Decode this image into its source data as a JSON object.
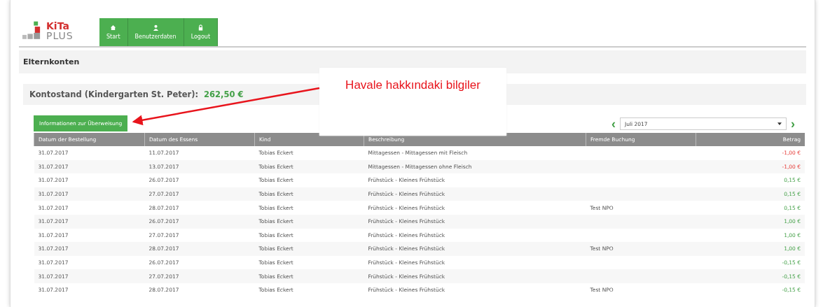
{
  "logo": {
    "top": "KiTa",
    "bottom": "PLUS"
  },
  "nav": [
    {
      "label": "Start",
      "kind": "home"
    },
    {
      "label": "Benutzerdaten",
      "kind": "user"
    },
    {
      "label": "Logout",
      "kind": "lock"
    }
  ],
  "page_title": "Elternkonten",
  "balance": {
    "label": "Kontostand (Kindergarten St. Peter):",
    "amount": "262,50 €"
  },
  "transfer_button": "Informationen zur Überweisung",
  "month_select": {
    "value": "Juli 2017",
    "prev": "‹",
    "next": "›"
  },
  "table": {
    "columns": [
      "Datum der Bestellung",
      "Datum des Essens",
      "Kind",
      "Beschreibung",
      "Fremde Buchung",
      "Betrag"
    ],
    "rows": [
      {
        "cells": [
          "31.07.2017",
          "11.07.2017",
          "Tobias Eckert",
          "Mittagessen - Mittagessen mit Fleisch",
          "",
          "-1,00 €"
        ],
        "negative": true
      },
      {
        "cells": [
          "31.07.2017",
          "13.07.2017",
          "Tobias Eckert",
          "Mittagessen - Mittagessen ohne Fleisch",
          "",
          "-1,00 €"
        ],
        "negative": true
      },
      {
        "cells": [
          "31.07.2017",
          "26.07.2017",
          "Tobias Eckert",
          "Frühstück - Kleines Frühstück",
          "",
          "0,15 €"
        ],
        "negative": false
      },
      {
        "cells": [
          "31.07.2017",
          "27.07.2017",
          "Tobias Eckert",
          "Frühstück - Kleines Frühstück",
          "",
          "0,15 €"
        ],
        "negative": false
      },
      {
        "cells": [
          "31.07.2017",
          "28.07.2017",
          "Tobias Eckert",
          "Frühstück - Kleines Frühstück",
          "Test NPO",
          "0,15 €"
        ],
        "negative": false
      },
      {
        "cells": [
          "31.07.2017",
          "26.07.2017",
          "Tobias Eckert",
          "Frühstück - Kleines Frühstück",
          "",
          "1,00 €"
        ],
        "negative": false
      },
      {
        "cells": [
          "31.07.2017",
          "27.07.2017",
          "Tobias Eckert",
          "Frühstück - Kleines Frühstück",
          "",
          "1,00 €"
        ],
        "negative": false
      },
      {
        "cells": [
          "31.07.2017",
          "28.07.2017",
          "Tobias Eckert",
          "Frühstück - Kleines Frühstück",
          "Test NPO",
          "1,00 €"
        ],
        "negative": false
      },
      {
        "cells": [
          "31.07.2017",
          "26.07.2017",
          "Tobias Eckert",
          "Frühstück - Kleines Frühstück",
          "",
          "-0,15 €"
        ],
        "negative": false
      },
      {
        "cells": [
          "31.07.2017",
          "27.07.2017",
          "Tobias Eckert",
          "Frühstück - Kleines Frühstück",
          "",
          "-0,15 €"
        ],
        "negative": false
      },
      {
        "cells": [
          "31.07.2017",
          "28.07.2017",
          "Tobias Eckert",
          "Frühstück - Kleines Frühstück",
          "Test NPO",
          "-0,15 €"
        ],
        "negative": false
      }
    ]
  },
  "annotation": {
    "text": "Havale hakkındaki bilgiler"
  }
}
